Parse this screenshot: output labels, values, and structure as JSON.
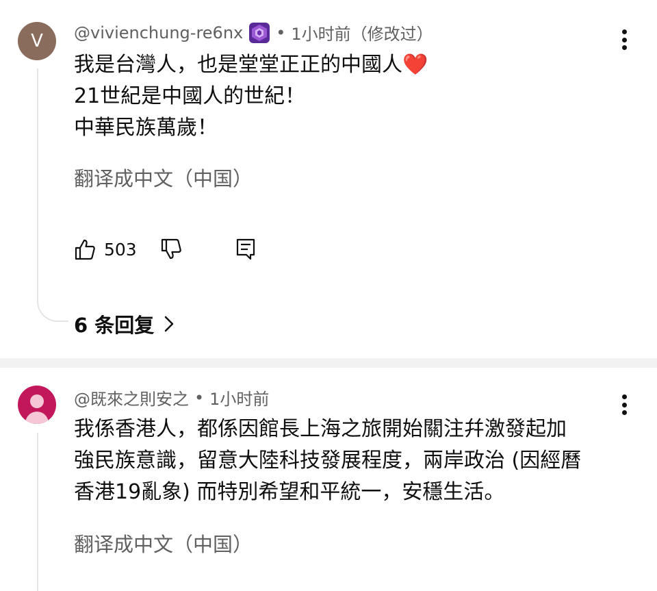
{
  "comments": [
    {
      "avatar_letter": "V",
      "username": "@vivienchung-re6nx",
      "time": "1小时前（修改过）",
      "lines": [
        "我是台灣人，也是堂堂正正的中國人❤️",
        "21世紀是中國人的世紀！",
        "中華民族萬歲！"
      ],
      "translate": "翻译成中文（中国）",
      "likes": "503",
      "replies": "6 条回复"
    },
    {
      "username": "@既來之則安之",
      "time": "1小时前",
      "lines": [
        "我係香港人，都係因館長上海之旅開始關注幷激發起加",
        "強民族意識，留意大陸科技發展程度，兩岸政治 (因經曆",
        "香港19亂象) 而特別希望和平統一，安穩生活。"
      ],
      "translate": "翻译成中文（中国）"
    }
  ],
  "separator": "•",
  "colors": {
    "avatar_brown": "#8a6c5c",
    "avatar_pink": "#c2185b",
    "badge_purple": "#7b3fbf",
    "secondary_text": "#606060"
  },
  "icons": {
    "like": "thumbs-up-icon",
    "dislike": "thumbs-down-icon",
    "reply": "reply-comment-icon",
    "more": "vertical-dots-icon",
    "replies_chevron": "chevron-right-icon",
    "member_badge": "member-badge-icon"
  }
}
